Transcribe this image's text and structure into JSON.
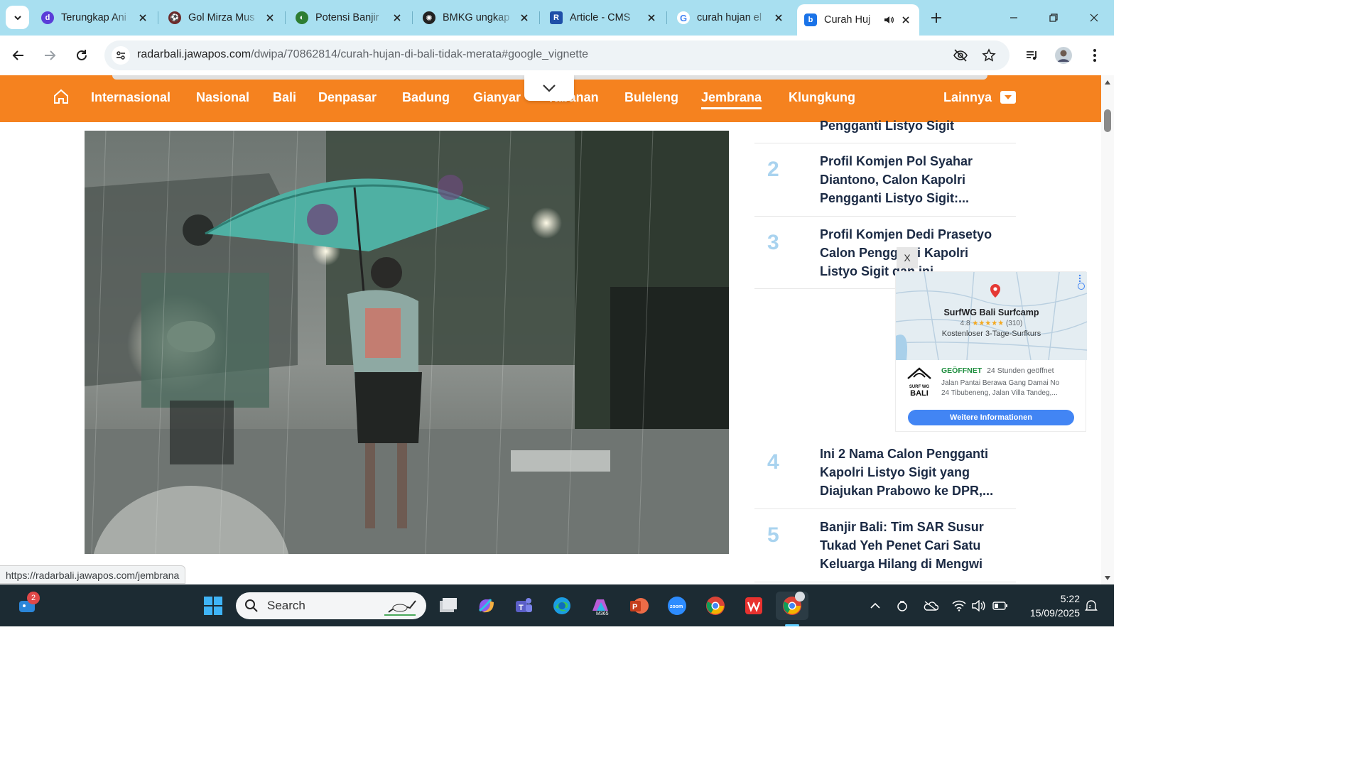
{
  "tabs": [
    {
      "title": "Terungkap Ani",
      "favicon_color": "#5a3dd8",
      "favicon_letter": "d"
    },
    {
      "title": "Gol Mirza Mus",
      "favicon_color": "#6b2b2b",
      "favicon_letter": "⚽"
    },
    {
      "title": "Potensi Banjir",
      "favicon_color": "#2e7d32",
      "favicon_letter": "◐"
    },
    {
      "title": "BMKG ungkap",
      "favicon_color": "#222222",
      "favicon_letter": "✺"
    },
    {
      "title": "Article - CMS",
      "favicon_color": "#1e4fa8",
      "favicon_letter": "R"
    },
    {
      "title": "curah hujan el",
      "favicon_color": "#ffffff",
      "favicon_letter": "G"
    },
    {
      "title": "Curah Huj",
      "favicon_color": "#1a73e8",
      "favicon_letter": "b"
    }
  ],
  "address_bar": {
    "url_host": "radarbali.jawapos.com",
    "url_path": "/dwipa/70862814/curah-hujan-di-bali-tidak-merata#google_vignette"
  },
  "nav": {
    "items": [
      "Internasional",
      "Nasional",
      "Bali",
      "Denpasar",
      "Badung",
      "Gianyar",
      "Tabanan",
      "Buleleng",
      "Jembrana",
      "Klungkung"
    ],
    "active": "Jembrana",
    "more_label": "Lainnya",
    "accent": "#f5821f"
  },
  "sidebar": {
    "partial_title": "Pengganti Listyo Sigit",
    "items": [
      {
        "num": "2",
        "title": "Profil Komjen Pol Syahar Diantono, Calon Kapolri Pengganti Listyo Sigit:..."
      },
      {
        "num": "3",
        "title": "Profil Komjen Dedi Prasetyo Calon Pengganti Kapolri Listyo Sigit dan ini..."
      },
      {
        "num": "4",
        "title": "Ini 2 Nama Calon Pengganti Kapolri Listyo Sigit yang Diajukan Prabowo ke DPR,..."
      },
      {
        "num": "5",
        "title": "Banjir Bali: Tim SAR Susur Tukad Yeh Penet Cari Satu Keluarga Hilang di Mengwi"
      }
    ]
  },
  "ad": {
    "close_label": "X",
    "business_name": "SurfWG Bali Surfcamp",
    "rating": "4.8",
    "stars": "★★★★★",
    "reviews": "(310)",
    "tagline": "Kostenloser 3-Tage-Surfkurs",
    "status": "GEÖFFNET",
    "hours": "24 Stunden geöffnet",
    "address_line1": "Jalan Pantai Berawa Gang Damai No",
    "address_line2": "24 Tibubeneng, Jalan Villa Tandeg,...",
    "cta": "Weitere Informationen",
    "logo_text_1": "SURF WG",
    "logo_text_2": "BALI"
  },
  "status_link": "https://radarbali.jawapos.com/jembrana",
  "taskbar": {
    "search_placeholder": "Search",
    "notification_count": "2",
    "time": "5:22",
    "date": "15/09/2025",
    "apps": [
      "windows-start",
      "file-explorer",
      "copilot",
      "teams",
      "edge",
      "microsoft-365",
      "powerpoint",
      "zoom",
      "chrome",
      "wps",
      "chrome-active"
    ]
  }
}
